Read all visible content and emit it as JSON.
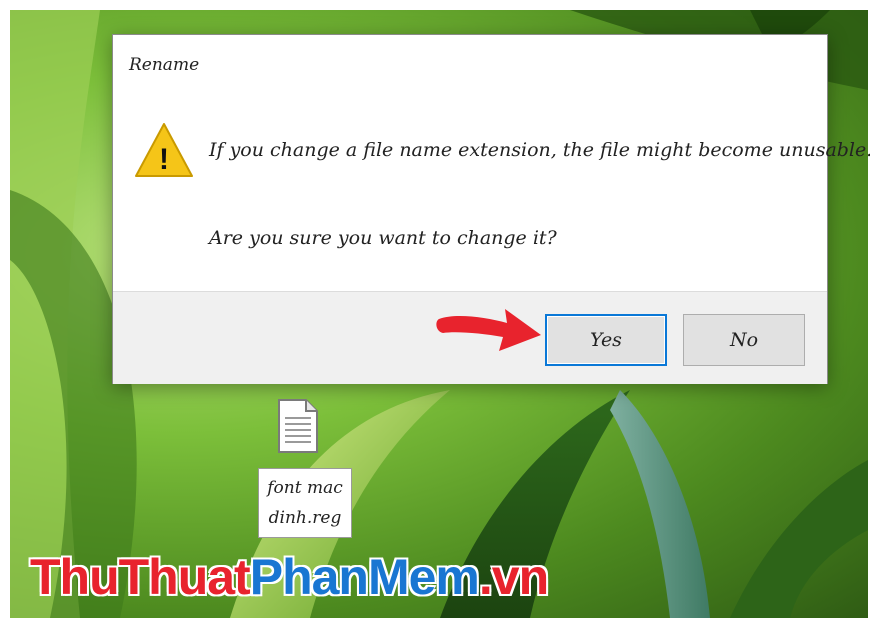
{
  "dialog": {
    "title": "Rename",
    "message_line1": "If you change a file name extension, the file might become unusable.",
    "message_line2": "Are you sure you want to change it?",
    "warning_icon_glyph": "!",
    "buttons": {
      "yes_label": "Yes",
      "no_label": "No"
    }
  },
  "desktop": {
    "file": {
      "name_line1": "font mac",
      "name_line2": "dinh.reg"
    }
  },
  "watermark": {
    "part1": "ThuThuat",
    "part2": "PhanMem",
    "part3": ".vn"
  },
  "colors": {
    "focus_border": "#0a78d7",
    "arrow": "#e8232d",
    "warning_fill": "#f5c518",
    "watermark_red": "#e8232d",
    "watermark_blue": "#1976d2"
  },
  "icons": [
    "warning-triangle-icon",
    "red-arrow-icon",
    "document-file-icon"
  ]
}
